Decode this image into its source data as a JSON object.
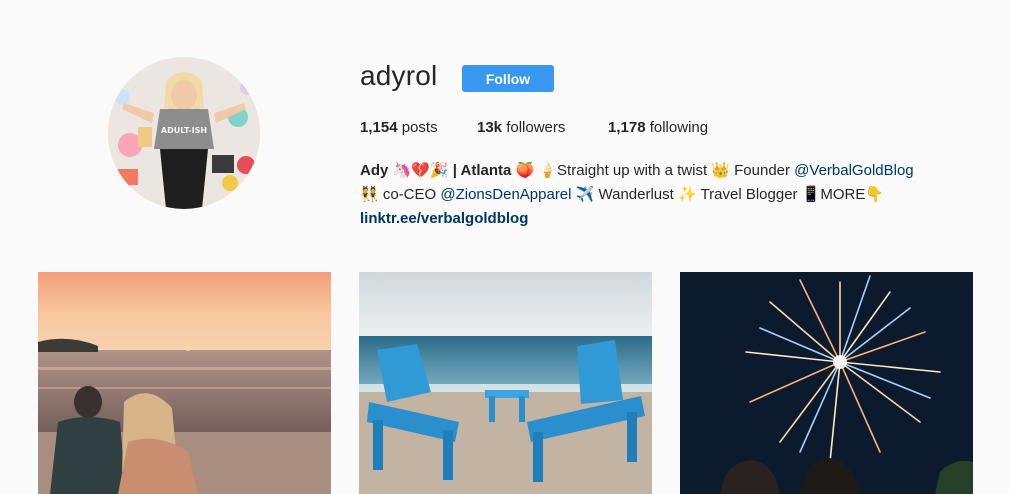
{
  "profile": {
    "username": "adyrol",
    "follow_label": "Follow",
    "stats": {
      "posts_count": "1,154",
      "posts_label": "posts",
      "followers_count": "13k",
      "followers_label": "followers",
      "following_count": "1,178",
      "following_label": "following"
    },
    "bio": {
      "name": "Ady 🦄💔🎉 | Atlanta",
      "line1_after_name": " 🍑 🍦Straight up with a twist 👑 Founder ",
      "mention1": "@VerbalGoldBlog",
      "line2_start": "👯 co-CEO ",
      "mention2": "@ZionsDenApparel",
      "line2_end": " ✈️ Wanderlust ✨ Travel Blogger 📱MORE👇",
      "link": "linktr.ee/verbalgoldblog"
    }
  },
  "avatar_text": "ADULT-ISH",
  "posts": [
    {
      "name": "sunset-couple-beach"
    },
    {
      "name": "blue-adirondack-chairs"
    },
    {
      "name": "fireworks-night"
    }
  ],
  "colors": {
    "accent": "#3897f0",
    "link": "#003569",
    "background": "#fafafa"
  }
}
